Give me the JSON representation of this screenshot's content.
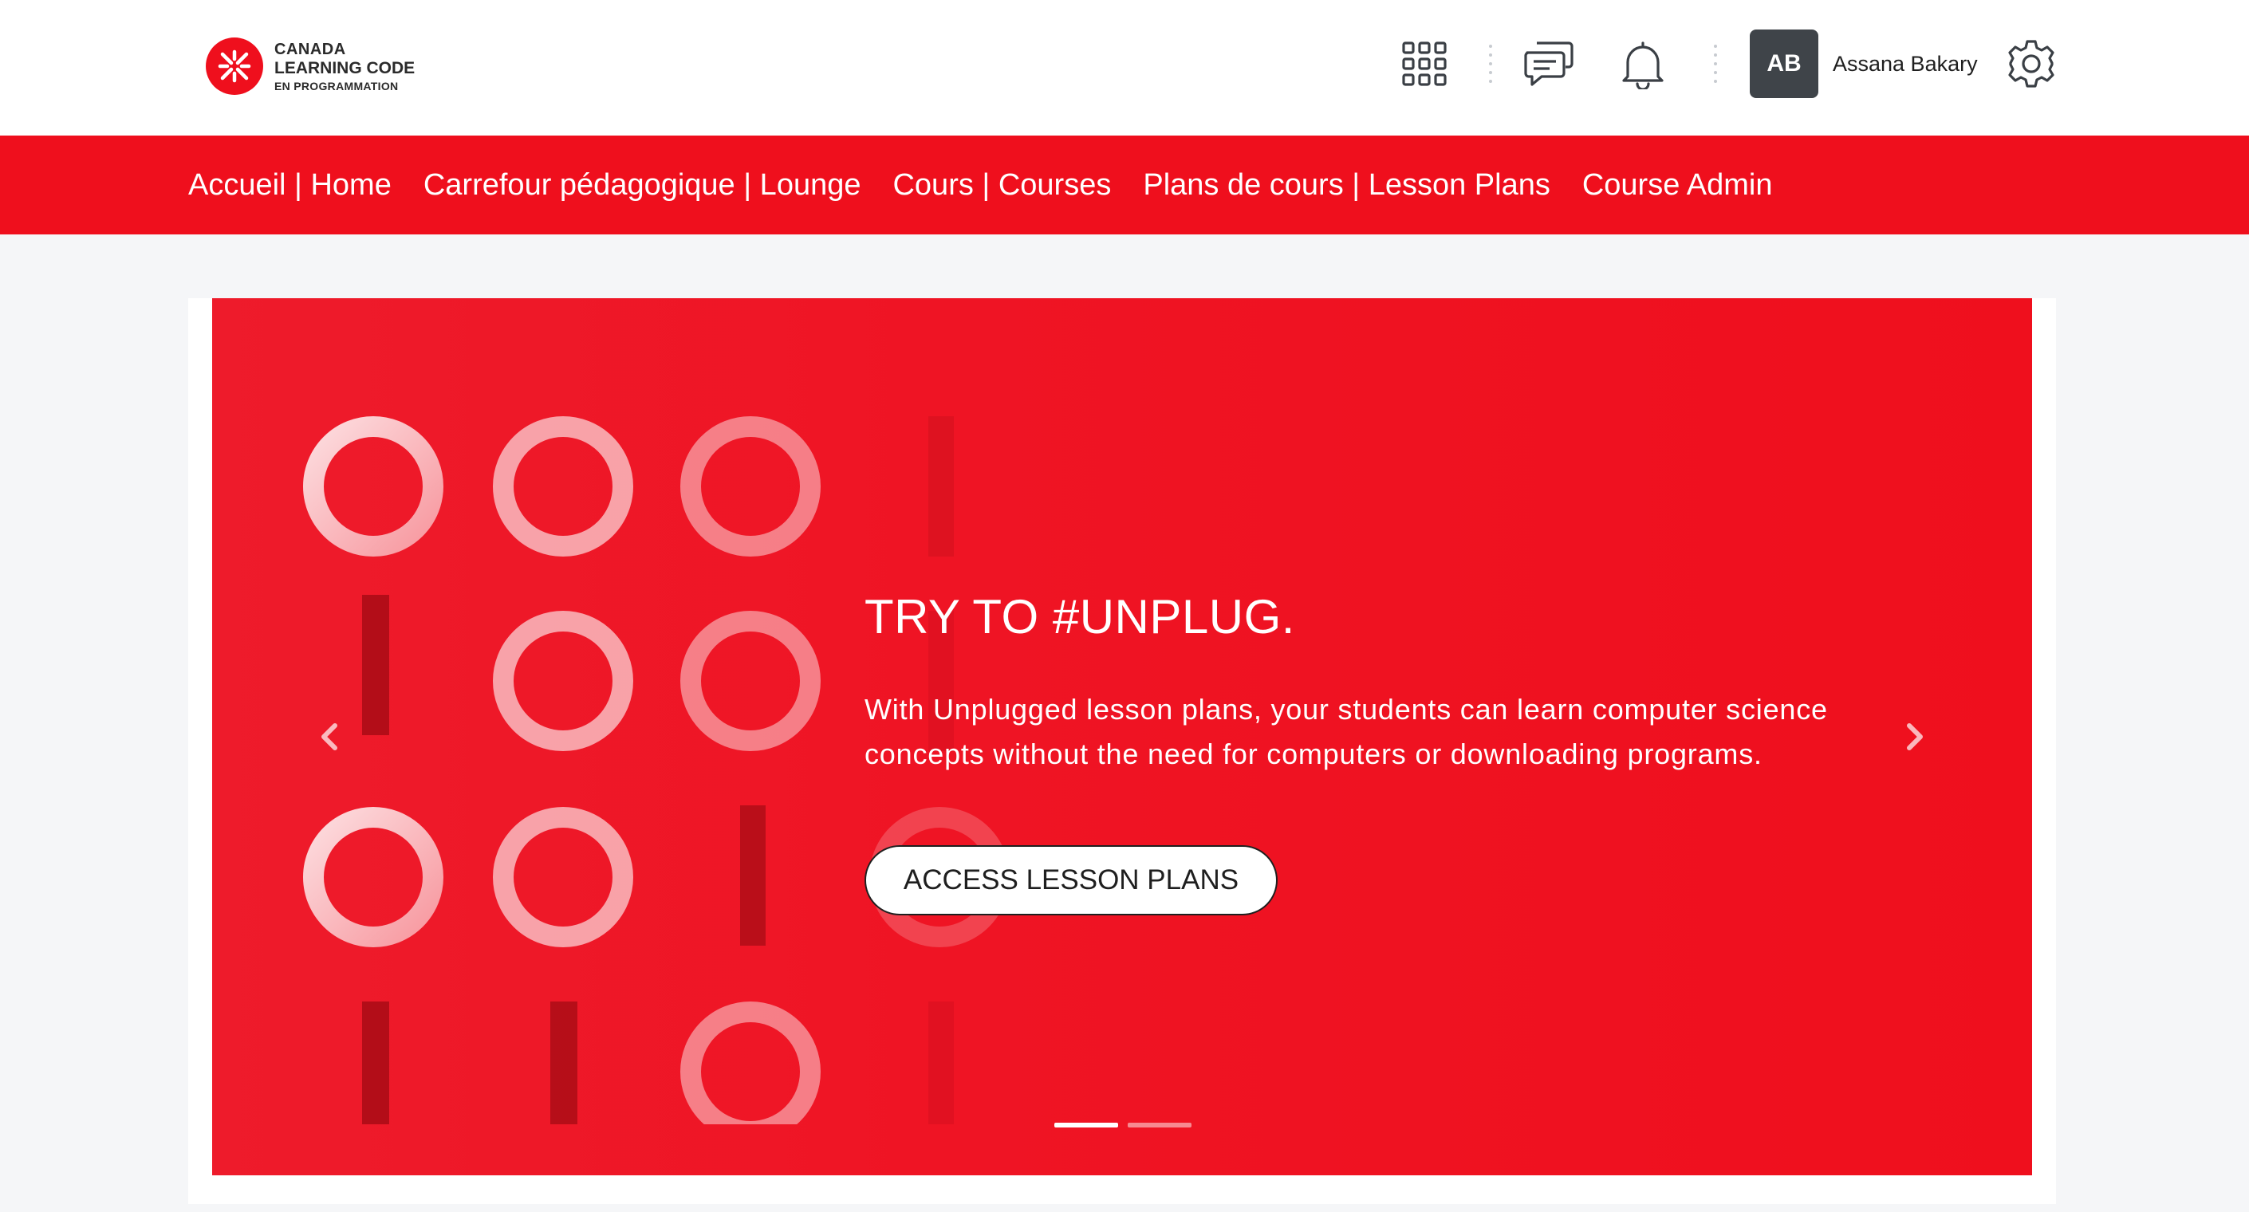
{
  "brand": {
    "line1": "CANADA",
    "line2": "LEARNING CODE",
    "line3": "EN PROGRAMMATION",
    "accent_color": "#ef0f1d"
  },
  "header": {
    "icons": {
      "apps": "apps-grid-icon",
      "messages": "chat-bubbles-icon",
      "notifications": "bell-icon",
      "settings": "gear-icon"
    },
    "user": {
      "initials": "AB",
      "name": "Assana Bakary"
    }
  },
  "nav": {
    "items": [
      {
        "label": "Accueil | Home"
      },
      {
        "label": "Carrefour pédagogique | Lounge"
      },
      {
        "label": "Cours | Courses"
      },
      {
        "label": "Plans de cours | Lesson Plans"
      },
      {
        "label": "Course Admin"
      }
    ]
  },
  "carousel": {
    "title": "TRY TO #UNPLUG.",
    "body": "With Unplugged lesson plans, your students can learn computer science concepts without the need for computers or downloading programs.",
    "cta_label": "ACCESS LESSON PLANS",
    "prev_icon": "chevron-left-icon",
    "next_icon": "chevron-right-icon",
    "slide_count": 2,
    "active_slide": 1
  }
}
